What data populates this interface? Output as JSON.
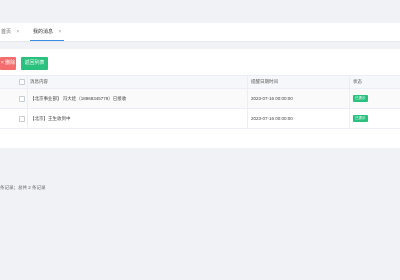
{
  "tabs": [
    {
      "label": "首页",
      "close": "×"
    },
    {
      "label": "我的消息",
      "close": "×"
    }
  ],
  "toolbar": {
    "delete_label": "× 删除",
    "return_label": "返回列表"
  },
  "table": {
    "headers": {
      "content": "消息内容",
      "time": "提醒日期时间",
      "status": "状态"
    },
    "rows": [
      {
        "content": "【北京事业部】 冯大娃（18968345779）已接收",
        "time": "2023-07-16 00:00:00",
        "status": "已提示"
      },
      {
        "content": "【北京】王生收到中",
        "time": "2023-07-16 00:00:00",
        "status": "已提示"
      }
    ]
  },
  "footer": "条记录；总共 2 条记录",
  "colors": {
    "delete": "#f56c6c",
    "return": "#29c17d",
    "status_badge": "#29c17d",
    "active_tab_underline": "#3a8ee6"
  }
}
